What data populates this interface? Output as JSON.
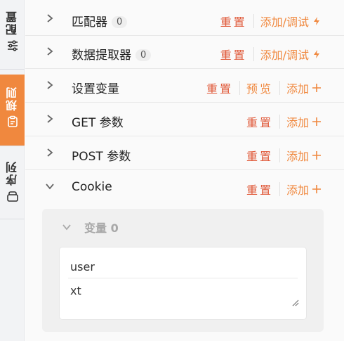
{
  "sidebar": {
    "tabs": [
      {
        "label": "配置",
        "icon": "sliders-icon",
        "active": false
      },
      {
        "label": "规则",
        "icon": "clipboard-icon",
        "active": true
      },
      {
        "label": "序列",
        "icon": "stack-icon",
        "active": false
      }
    ]
  },
  "colors": {
    "accent": "#f0883e",
    "reset": "#e05a3a"
  },
  "rows": [
    {
      "title": "匹配器",
      "badge": "0",
      "reset": "重置",
      "add": "添加/调试",
      "add_icon": "lightning-icon"
    },
    {
      "title": "数据提取器",
      "badge": "0",
      "reset": "重置",
      "add": "添加/调试",
      "add_icon": "lightning-icon"
    },
    {
      "title": "设置变量",
      "reset": "重置",
      "preview": "预览",
      "add": "添加",
      "add_icon": "plus-icon"
    },
    {
      "title": "GET 参数",
      "reset": "重置",
      "add": "添加",
      "add_icon": "plus-icon"
    },
    {
      "title": "POST 参数",
      "reset": "重置",
      "add": "添加",
      "add_icon": "plus-icon"
    },
    {
      "title": "Cookie",
      "expanded": true,
      "reset": "重置",
      "add": "添加",
      "add_icon": "plus-icon"
    }
  ],
  "cookie": {
    "variables_title": "变量 0",
    "key": "user",
    "value": "xt"
  }
}
